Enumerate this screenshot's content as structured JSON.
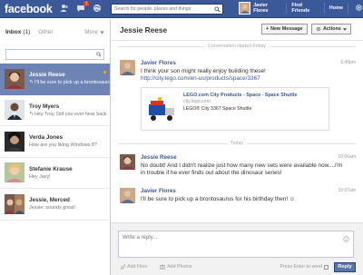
{
  "topbar": {
    "logo": "facebook",
    "notification_count": "1",
    "search_placeholder": "Search for people, places and things",
    "user_name": "Javier Flores",
    "find_friends": "Find Friends",
    "home": "Home",
    "color": "#3b5998"
  },
  "sidebar": {
    "inbox_label": "Inbox",
    "inbox_count": "(1)",
    "other_label": "Other",
    "more_label": "More",
    "search_value": "",
    "threads": [
      {
        "name": "Jessie Reese",
        "snippet": "↰ I'll be sure to pick up a brontosaurus",
        "active": true,
        "avatar": "woman-dark-hair"
      },
      {
        "name": "Troy Myers",
        "snippet": "↰ Hey Troy, Did you ever hear back",
        "active": false,
        "avatar": "man-suit"
      },
      {
        "name": "Verda Jones",
        "snippet": "How are you liking Windows 8?",
        "active": false,
        "avatar": "woman-dark"
      },
      {
        "name": "Stefanie Krause",
        "snippet": "Hey Javy!",
        "active": false,
        "avatar": "woman-blonde"
      },
      {
        "name": "Jessie, Merced",
        "snippet": "Jessie: sounds great!",
        "active": false,
        "avatar": "group"
      }
    ]
  },
  "conversation": {
    "title": "Jessie Reese",
    "new_message_label": "New Message",
    "actions_label": "Actions",
    "started_label": "Conversation started Friday",
    "today_label": "Today",
    "messages": [
      {
        "sender": "Javier Flores",
        "time": "6:49pm",
        "text": "I think your son might really enjoy building these!",
        "link": "http://city.lego.com/en-us/products/space/3367"
      },
      {
        "sender": "Jessie Reese",
        "time": "10:06am",
        "text": "No doubt! And I didn't realize just how many new sets were available now....I'm in trouble if he ever finds out about the dinosaur series!"
      },
      {
        "sender": "Javier Flores",
        "time": "10:07am",
        "text": "I'll be sure to pick up a brontosaurus for his birthday then! ☺"
      }
    ],
    "attachment": {
      "title": "LEGO.com City Products - Space - Space Shuttle",
      "domain": "city.lego.com",
      "description": "LEGO® City 3367 Space Shuttle"
    }
  },
  "composer": {
    "placeholder": "Write a reply...",
    "add_files": "Add Files",
    "add_photos": "Add Photos",
    "enter_to_send": "Press Enter to send",
    "reply_label": "Reply"
  }
}
